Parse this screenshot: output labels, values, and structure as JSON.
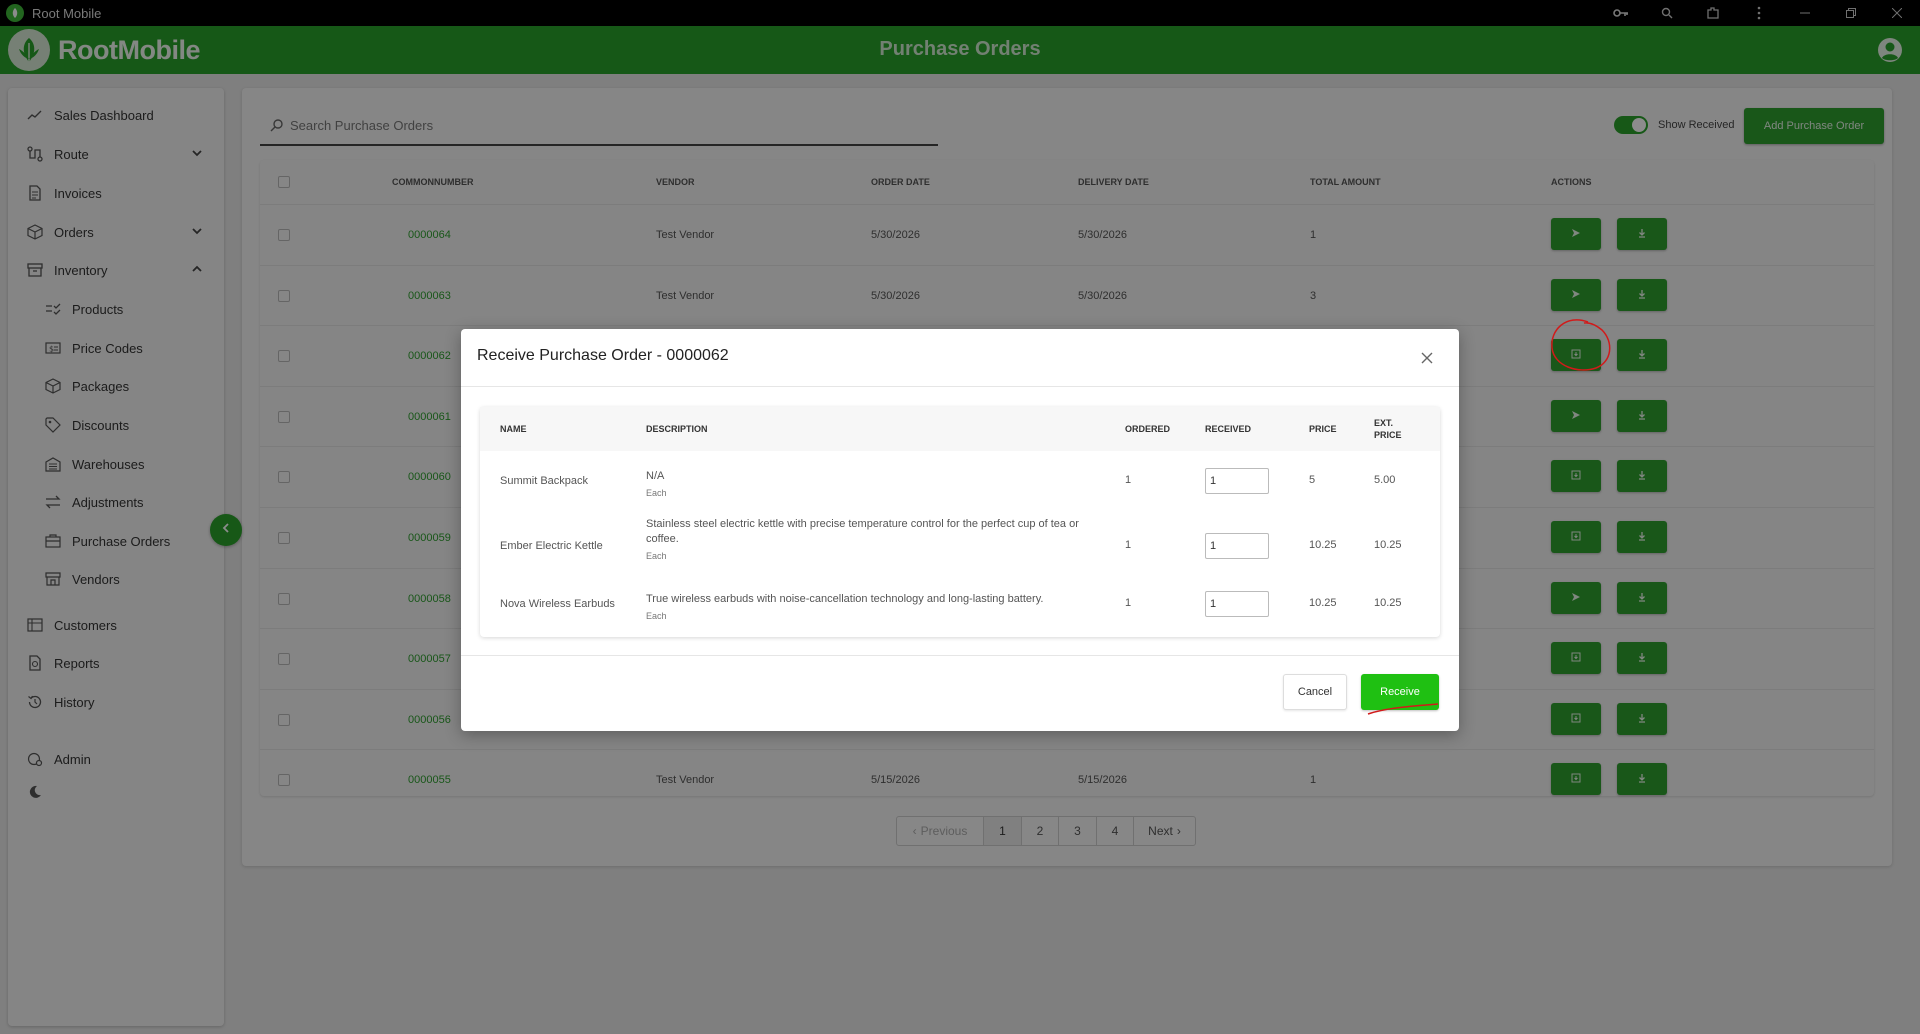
{
  "window": {
    "title": "Root Mobile"
  },
  "header": {
    "brand": "RootMobile",
    "page_title": "Purchase Orders"
  },
  "sidebar": {
    "items": [
      {
        "label": "Sales Dashboard",
        "icon": "chart-line-icon"
      },
      {
        "label": "Route",
        "icon": "route-icon"
      },
      {
        "label": "Invoices",
        "icon": "invoice-icon"
      },
      {
        "label": "Orders",
        "icon": "box-icon"
      },
      {
        "label": "Inventory",
        "icon": "archive-icon"
      },
      {
        "label": "Products",
        "icon": "list-check-icon"
      },
      {
        "label": "Price Codes",
        "icon": "dollar-tag-icon"
      },
      {
        "label": "Packages",
        "icon": "package-icon"
      },
      {
        "label": "Discounts",
        "icon": "tag-icon"
      },
      {
        "label": "Warehouses",
        "icon": "warehouse-icon"
      },
      {
        "label": "Adjustments",
        "icon": "arrows-exchange-icon"
      },
      {
        "label": "Purchase Orders",
        "icon": "briefcase-icon"
      },
      {
        "label": "Vendors",
        "icon": "store-icon"
      },
      {
        "label": "Customers",
        "icon": "users-icon"
      },
      {
        "label": "Reports",
        "icon": "report-icon"
      },
      {
        "label": "History",
        "icon": "history-icon"
      },
      {
        "label": "Admin",
        "icon": "admin-icon"
      }
    ]
  },
  "toolbar": {
    "search_placeholder": "Search Purchase Orders",
    "show_received_label": "Show Received",
    "show_received_on": true,
    "add_button": "Add Purchase Order"
  },
  "table": {
    "columns": [
      "COMMONNUMBER",
      "VENDOR",
      "ORDER DATE",
      "DELIVERY DATE",
      "TOTAL AMOUNT",
      "ACTIONS"
    ],
    "rows": [
      {
        "number": "0000064",
        "vendor": "Test Vendor",
        "order_date": "5/30/2026",
        "delivery_date": "5/30/2026",
        "total": "1",
        "action_icon": "send-icon"
      },
      {
        "number": "0000063",
        "vendor": "Test Vendor",
        "order_date": "5/30/2026",
        "delivery_date": "5/30/2026",
        "total": "3",
        "action_icon": "send-icon"
      },
      {
        "number": "0000062",
        "vendor": "",
        "order_date": "",
        "delivery_date": "",
        "total": "",
        "action_icon": "receive-icon"
      },
      {
        "number": "0000061",
        "vendor": "",
        "order_date": "",
        "delivery_date": "",
        "total": "",
        "action_icon": "send-icon"
      },
      {
        "number": "0000060",
        "vendor": "",
        "order_date": "",
        "delivery_date": "",
        "total": "",
        "action_icon": "receive-icon"
      },
      {
        "number": "0000059",
        "vendor": "",
        "order_date": "",
        "delivery_date": "",
        "total": "",
        "action_icon": "receive-icon"
      },
      {
        "number": "0000058",
        "vendor": "",
        "order_date": "",
        "delivery_date": "",
        "total": "",
        "action_icon": "send-icon"
      },
      {
        "number": "0000057",
        "vendor": "",
        "order_date": "",
        "delivery_date": "",
        "total": "",
        "action_icon": "receive-icon"
      },
      {
        "number": "0000056",
        "vendor": "",
        "order_date": "",
        "delivery_date": "",
        "total": "",
        "action_icon": "receive-icon"
      },
      {
        "number": "0000055",
        "vendor": "Test Vendor",
        "order_date": "5/15/2026",
        "delivery_date": "5/15/2026",
        "total": "1",
        "action_icon": "receive-icon"
      }
    ]
  },
  "pagination": {
    "previous": "Previous",
    "pages": [
      "1",
      "2",
      "3",
      "4"
    ],
    "active_page": "1",
    "next": "Next"
  },
  "modal": {
    "title": "Receive Purchase Order - 0000062",
    "columns": [
      "NAME",
      "DESCRIPTION",
      "ORDERED",
      "RECEIVED",
      "PRICE",
      "EXT. PRICE"
    ],
    "items": [
      {
        "name": "Summit Backpack",
        "description": "N/A",
        "unit": "Each",
        "ordered": "1",
        "received": "1",
        "price": "5",
        "ext_price": "5.00"
      },
      {
        "name": "Ember Electric Kettle",
        "description": "Stainless steel electric kettle with precise temperature control for the perfect cup of tea or coffee.",
        "unit": "Each",
        "ordered": "1",
        "received": "1",
        "price": "10.25",
        "ext_price": "10.25"
      },
      {
        "name": "Nova Wireless Earbuds",
        "description": "True wireless earbuds with noise-cancellation technology and long-lasting battery.",
        "unit": "Each",
        "ordered": "1",
        "received": "1",
        "price": "10.25",
        "ext_price": "10.25"
      }
    ],
    "cancel": "Cancel",
    "receive": "Receive"
  },
  "colors": {
    "brand_green": "#29a12a",
    "receive_green": "#1fc012",
    "annotation_red": "#d11a1a"
  }
}
